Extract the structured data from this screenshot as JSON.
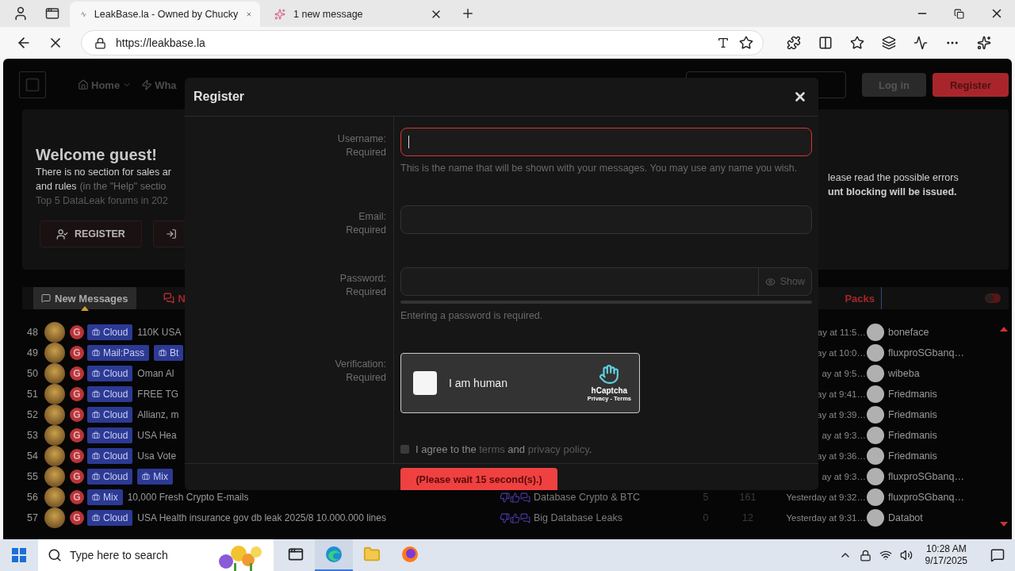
{
  "browser": {
    "tabs": [
      {
        "title": "LeakBase.la - Owned by Chucky",
        "selected": true
      },
      {
        "title": "1 new message",
        "selected": false
      }
    ],
    "address": "https://leakbase.la"
  },
  "header": {
    "nav": [
      {
        "label": "Home",
        "caret": true
      },
      {
        "label": "Wha",
        "caret": false
      }
    ],
    "login": "Log in",
    "register": "Register"
  },
  "welcome": {
    "title": "Welcome guest!",
    "left_lines": [
      [
        {
          "text": "There is no section for sales ar",
          "kind": "plain"
        }
      ],
      [
        {
          "text": "and rules",
          "kind": "plain"
        },
        {
          "text": "(in the \"Help\" sectio",
          "kind": "muted"
        }
      ],
      [
        {
          "text": "Top 5 DataLeak forums in 202",
          "kind": "faint"
        }
      ]
    ],
    "right_lines": [
      [
        {
          "text": "lease read the possible errors",
          "kind": "plain"
        }
      ],
      [
        {
          "text": "unt blocking will be issued.",
          "kind": "bold"
        }
      ]
    ],
    "register_button": "REGISTER"
  },
  "tabs": [
    {
      "label": "New Messages",
      "selected": true
    },
    {
      "label": "N",
      "selected": false
    }
  ],
  "right_tab": {
    "label": "Packs",
    "selected": false
  },
  "toggle": {
    "on": false
  },
  "rows": [
    {
      "num": "48",
      "badge": "G",
      "tags": [
        "Cloud"
      ],
      "title": "110K USA",
      "time": "ay at 11:5…",
      "user": "boneface"
    },
    {
      "num": "49",
      "badge": "G",
      "tags": [
        "Mail:Pass",
        "Bt"
      ],
      "time": "ay at 10:0…",
      "user": "fluxproSGbanq…"
    },
    {
      "num": "50",
      "badge": "G",
      "tags": [
        "Cloud"
      ],
      "title": "Oman Al",
      "time": "ay at 9:5…",
      "user": "wibeba"
    },
    {
      "num": "51",
      "badge": "G",
      "tags": [
        "Cloud"
      ],
      "title": "FREE TG",
      "time": "ay at 9:41…",
      "user": "Friedmanis"
    },
    {
      "num": "52",
      "badge": "G",
      "tags": [
        "Cloud"
      ],
      "title": "Allianz, m",
      "time": "ay at 9:39…",
      "user": "Friedmanis"
    },
    {
      "num": "53",
      "badge": "G",
      "tags": [
        "Cloud"
      ],
      "title": "USA Hea",
      "time": "ay at 9:3…",
      "user": "Friedmanis"
    },
    {
      "num": "54",
      "badge": "G",
      "tags": [
        "Cloud"
      ],
      "title": "Usa Vote",
      "time": "ay at 9:36…",
      "user": "Friedmanis"
    },
    {
      "num": "55",
      "badge": "G",
      "tags": [
        "Cloud",
        "Mix"
      ],
      "time": "ay at 9:3…",
      "user": "fluxproSGbanq…"
    },
    {
      "num": "56",
      "badge": "G",
      "tags": [
        "Mix"
      ],
      "title": "10,000 Fresh Crypto E-mails",
      "forum": "Database Crypto & BTC",
      "replies": "5",
      "views": "161",
      "time": "Yesterday at 9:32…",
      "user": "fluxproSGbanq…"
    },
    {
      "num": "57",
      "badge": "G",
      "tags": [
        "Cloud"
      ],
      "title": "USA Health insurance gov db leak 2025/8 10.000.000 lines",
      "forum": "Big Database Leaks",
      "replies": "0",
      "views": "12",
      "time": "Yesterday at 9:31…",
      "user": "Databot"
    }
  ],
  "modal": {
    "title": "Register",
    "fields": [
      {
        "kind": "text",
        "label": "Username:",
        "note": "Required",
        "focused": true,
        "hint": "This is the name that will be shown with your messages. You may use any name you wish."
      },
      {
        "kind": "text",
        "label": "Email:",
        "note": "Required",
        "focused": false
      },
      {
        "kind": "password",
        "label": "Password:",
        "note": "Required",
        "focused": false,
        "show": "Show",
        "strength": {
          "level": 0
        },
        "hint": "Entering a password is required."
      },
      {
        "kind": "captcha",
        "label": "Verification:",
        "note": "Required",
        "checked": false,
        "text": "I am human",
        "brand": "hCaptcha",
        "links": "Privacy - Terms"
      }
    ],
    "agree": {
      "checked": false,
      "parts": [
        {
          "text": "I agree to the ",
          "link": false
        },
        {
          "text": "terms",
          "link": true
        },
        {
          "text": " and ",
          "link": false
        },
        {
          "text": "privacy policy",
          "link": true
        },
        {
          "text": ".",
          "link": false
        }
      ]
    },
    "submit": "(Please wait 15 second(s).)"
  },
  "taskbar": {
    "search_placeholder": "Type here to search",
    "apps": [
      {
        "kind": "taskview",
        "active": false
      },
      {
        "kind": "edge",
        "active": true
      },
      {
        "kind": "explorer",
        "active": false
      },
      {
        "kind": "firefox",
        "active": false
      }
    ],
    "time": "10:28 AM",
    "date": "9/17/2025"
  }
}
